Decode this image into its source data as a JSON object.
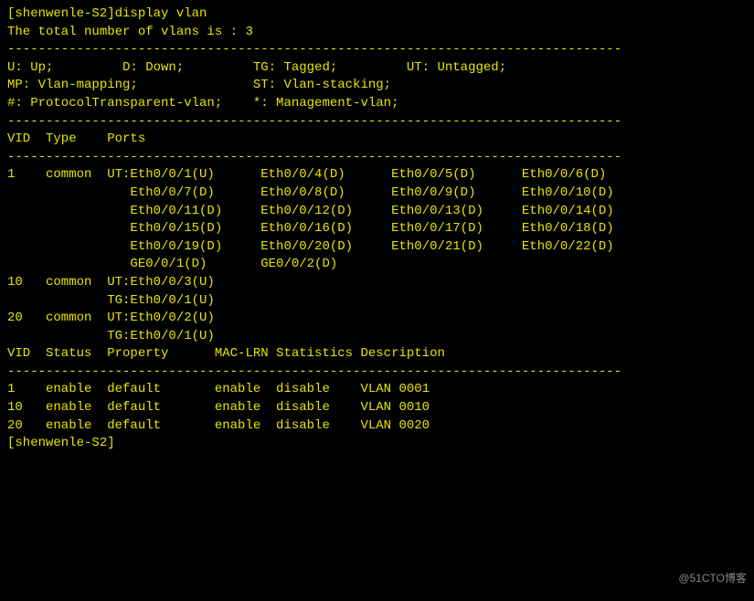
{
  "prompt_line": "[shenwenle-S2]display vlan",
  "total_line": "The total number of vlans is : 3",
  "dash_line": "--------------------------------------------------------------------------------",
  "legend1": "U: Up;         D: Down;         TG: Tagged;         UT: Untagged;",
  "legend2": "MP: Vlan-mapping;               ST: Vlan-stacking;",
  "legend3": "#: ProtocolTransparent-vlan;    *: Management-vlan;",
  "blank": "",
  "header_ports": "VID  Type    Ports",
  "port_lines": [
    "1    common  UT:Eth0/0/1(U)      Eth0/0/4(D)      Eth0/0/5(D)      Eth0/0/6(D)",
    "                Eth0/0/7(D)      Eth0/0/8(D)      Eth0/0/9(D)      Eth0/0/10(D)",
    "                Eth0/0/11(D)     Eth0/0/12(D)     Eth0/0/13(D)     Eth0/0/14(D)",
    "                Eth0/0/15(D)     Eth0/0/16(D)     Eth0/0/17(D)     Eth0/0/18(D)",
    "                Eth0/0/19(D)     Eth0/0/20(D)     Eth0/0/21(D)     Eth0/0/22(D)",
    "                GE0/0/1(D)       GE0/0/2(D)"
  ],
  "vlan10_ut": "10   common  UT:Eth0/0/3(U)",
  "vlan10_tg": "             TG:Eth0/0/1(U)",
  "vlan20_ut": "20   common  UT:Eth0/0/2(U)",
  "vlan20_tg": "             TG:Eth0/0/1(U)",
  "header_status": "VID  Status  Property      MAC-LRN Statistics Description",
  "status_lines": [
    "1    enable  default       enable  disable    VLAN 0001",
    "10   enable  default       enable  disable    VLAN 0010",
    "20   enable  default       enable  disable    VLAN 0020"
  ],
  "final_prompt": "[shenwenle-S2]",
  "watermark": "@51CTO博客"
}
